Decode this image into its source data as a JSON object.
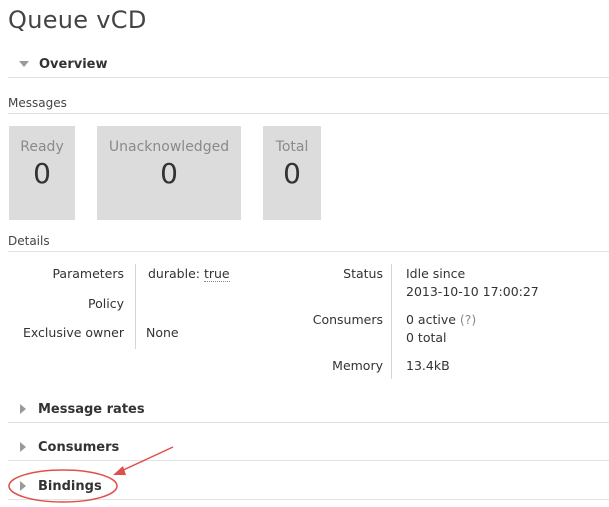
{
  "page": {
    "title": "Queue vCD"
  },
  "overview": {
    "header": "Overview",
    "messages_label": "Messages",
    "boxes": [
      {
        "label": "Ready",
        "value": "0"
      },
      {
        "label": "Unacknowledged",
        "value": "0"
      },
      {
        "label": "Total",
        "value": "0"
      }
    ],
    "details_label": "Details",
    "params": {
      "parameters_key": "Parameters",
      "parameters_value": "durable: true",
      "policy_key": "Policy",
      "policy_value": "",
      "exclusive_key": "Exclusive owner",
      "exclusive_value": "None"
    },
    "status": {
      "status_key": "Status",
      "status_line1": "Idle since",
      "status_line2": "2013-10-10 17:00:27",
      "consumers_key": "Consumers",
      "consumers_active": "0 active",
      "consumers_help": "(?)",
      "consumers_total": "0 total",
      "memory_key": "Memory",
      "memory_value": "13.4kB"
    }
  },
  "sections": {
    "message_rates": "Message rates",
    "consumers": "Consumers",
    "bindings": "Bindings"
  },
  "colors": {
    "box_bg": "#dcdcdc",
    "annotation_red": "#e0504a"
  }
}
